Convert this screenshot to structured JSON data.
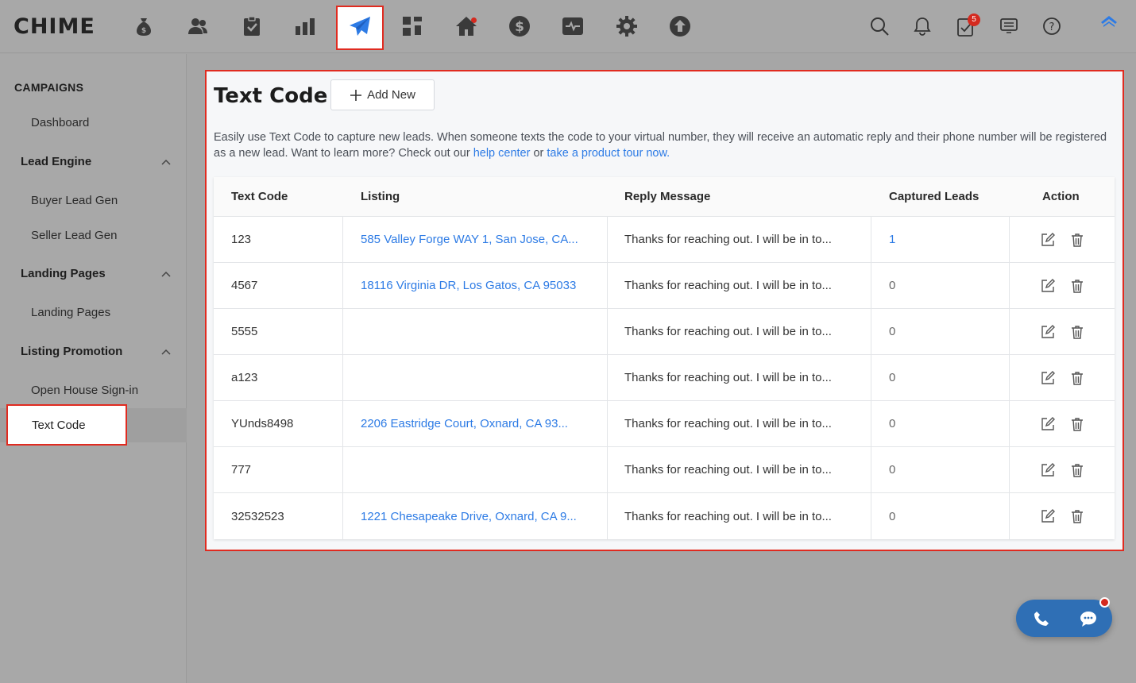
{
  "app": {
    "logo": "CHIME",
    "notification_badge": "5",
    "accent_color": "#2d7be5",
    "highlight_color": "#e02b20"
  },
  "topnav": {
    "icons": [
      "money-bag-icon",
      "people-icon",
      "clipboard-check-icon",
      "bar-chart-icon",
      "paper-plane-icon",
      "dashboard-grid-icon",
      "home-icon",
      "dollar-circle-icon",
      "activity-monitor-icon",
      "gear-icon",
      "upload-circle-icon"
    ],
    "right_icons": [
      "search-icon",
      "bell-icon",
      "tasks-icon",
      "presentation-icon",
      "help-icon",
      "home-outline-icon"
    ]
  },
  "sidebar": {
    "title": "CAMPAIGNS",
    "dashboard": "Dashboard",
    "groups": [
      {
        "label": "Lead Engine",
        "items": [
          "Buyer Lead Gen",
          "Seller Lead Gen"
        ]
      },
      {
        "label": "Landing Pages",
        "items": [
          "Landing Pages"
        ]
      },
      {
        "label": "Listing Promotion",
        "items": [
          "Open House Sign-in",
          "Text Code"
        ]
      }
    ],
    "active": "Text Code"
  },
  "page": {
    "title": "Text Code",
    "add_button": "Add New",
    "description_pre": "Easily use Text Code to capture new leads. When someone texts the code to your virtual number, they will receive an automatic reply and their phone number will be registered as a new lead. Want to learn more? Check out our ",
    "help_link": "help center",
    "description_mid": " or ",
    "tour_link": "take a product tour now.",
    "columns": [
      "Text Code",
      "Listing",
      "Reply Message",
      "Captured Leads",
      "Action"
    ],
    "rows": [
      {
        "code": "123",
        "listing": "585 Valley Forge WAY 1, San Jose, CA...",
        "reply": "Thanks for reaching out. I will be in to...",
        "leads": "1"
      },
      {
        "code": "4567",
        "listing": "18116 Virginia DR, Los Gatos, CA 95033",
        "reply": "Thanks for reaching out. I will be in to...",
        "leads": "0"
      },
      {
        "code": "5555",
        "listing": "",
        "reply": "Thanks for reaching out. I will be in to...",
        "leads": "0"
      },
      {
        "code": "a123",
        "listing": "",
        "reply": "Thanks for reaching out. I will be in to...",
        "leads": "0"
      },
      {
        "code": "YUnds8498",
        "listing": "2206 Eastridge Court, Oxnard, CA 93...",
        "reply": "Thanks for reaching out. I will be in to...",
        "leads": "0"
      },
      {
        "code": "777",
        "listing": "",
        "reply": "Thanks for reaching out. I will be in to...",
        "leads": "0"
      },
      {
        "code": "32532523",
        "listing": "1221 Chesapeake Drive, Oxnard, CA 9...",
        "reply": "Thanks for reaching out. I will be in to...",
        "leads": "0"
      }
    ]
  }
}
